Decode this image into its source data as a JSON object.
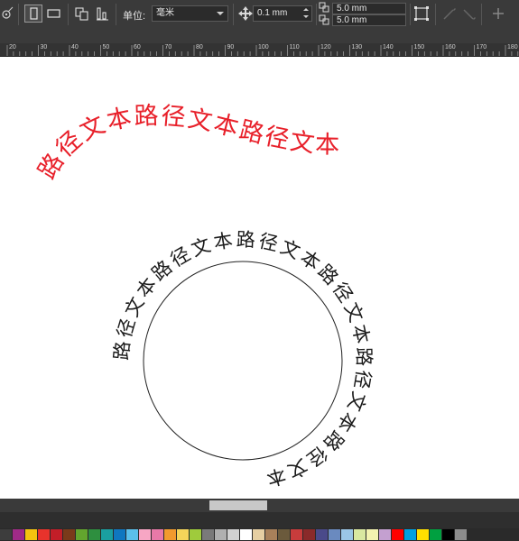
{
  "toolbar": {
    "unit_label": "单位:",
    "unit_value": "毫米",
    "nudge_value": "0.1 mm",
    "dup_x_value": "5.0 mm",
    "dup_y_value": "5.0 mm",
    "colors": {
      "background": "#3a3a3a",
      "text": "#e6e6e6",
      "field": "#2b2b2b"
    }
  },
  "ruler": {
    "labels": [
      "20",
      "30",
      "40",
      "50",
      "60",
      "70",
      "80",
      "90",
      "100",
      "110",
      "120",
      "130",
      "140",
      "150",
      "160",
      "170",
      "180"
    ]
  },
  "canvas": {
    "arc_text": "路径文本路径文本路径文本",
    "arc_text_color": "#e8202a",
    "circle_text": "路径文本路径文本路径文本路径文本路径文本路径文本",
    "circle_text_color": "#1a1a1a"
  },
  "palette": {
    "swatches": [
      "#3d3d3d",
      "#a02a87",
      "#f4c40f",
      "#e8332c",
      "#c21e28",
      "#7a3a1a",
      "#62a52e",
      "#2e8f3f",
      "#1a9fa0",
      "#0f77c0",
      "#5bc0eb",
      "#f7a6c4",
      "#e879a8",
      "#f29a2e",
      "#f5d55a",
      "#9fcb3c",
      "#7a7a7a",
      "#b0b0b0",
      "#d1d1d1",
      "#ffffff",
      "#e6cfa3",
      "#a8805a",
      "#6b5a3c",
      "#c83c3c",
      "#8a2a2a",
      "#4a4a8a",
      "#6a8abf",
      "#9bc6e6",
      "#d9e8a0",
      "#f3f3b0",
      "#c4a0d0",
      "#ff0000",
      "#00a0e0",
      "#ffe000",
      "#00a040",
      "#000000",
      "#8c8c8c"
    ]
  }
}
